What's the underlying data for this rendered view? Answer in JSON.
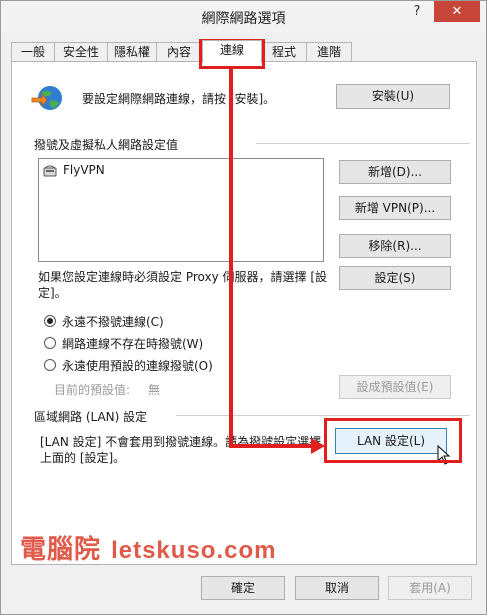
{
  "window": {
    "title": "網際網路選項",
    "help": "?",
    "close": "✕"
  },
  "tabs": [
    {
      "label": "一般"
    },
    {
      "label": "安全性"
    },
    {
      "label": "隱私權"
    },
    {
      "label": "內容"
    },
    {
      "label": "連線"
    },
    {
      "label": "程式"
    },
    {
      "label": "進階"
    }
  ],
  "setup": {
    "text": "要設定網際網路連線，請按 [安裝]。",
    "button": "安裝(U)"
  },
  "dialup": {
    "heading": "撥號及虛擬私人網路設定值",
    "entries": [
      {
        "name": "FlyVPN"
      }
    ],
    "add_button": "新增(D)...",
    "add_vpn_button": "新增 VPN(P)...",
    "remove_button": "移除(R)...",
    "settings_button": "設定(S)",
    "proxy_note_line1": "如果您設定連線時必須設定 Proxy 伺服器，請選擇 [設",
    "proxy_note_line2": "定]。",
    "options": [
      {
        "label": "永遠不撥號連線(C)",
        "checked": true
      },
      {
        "label": "網路連線不存在時撥號(W)",
        "checked": false
      },
      {
        "label": "永遠使用預設的連線撥號(O)",
        "checked": false
      }
    ],
    "default_label": "目前的預設值:",
    "default_value": "無",
    "set_default_button": "設成預設值(E)"
  },
  "lan": {
    "heading": "區域網路 (LAN) 設定",
    "note_line1": "[LAN 設定] 不會套用到撥號連線。請為撥號設定選擇",
    "note_line2": "上面的 [設定]。",
    "button": "LAN 設定(L)"
  },
  "footer": {
    "ok": "確定",
    "cancel": "取消",
    "apply": "套用(A)"
  },
  "watermark": {
    "cjk": "電腦院",
    "latin": "letskuso.com"
  },
  "colors": {
    "highlight": "#e02020",
    "close": "#c7463a"
  }
}
